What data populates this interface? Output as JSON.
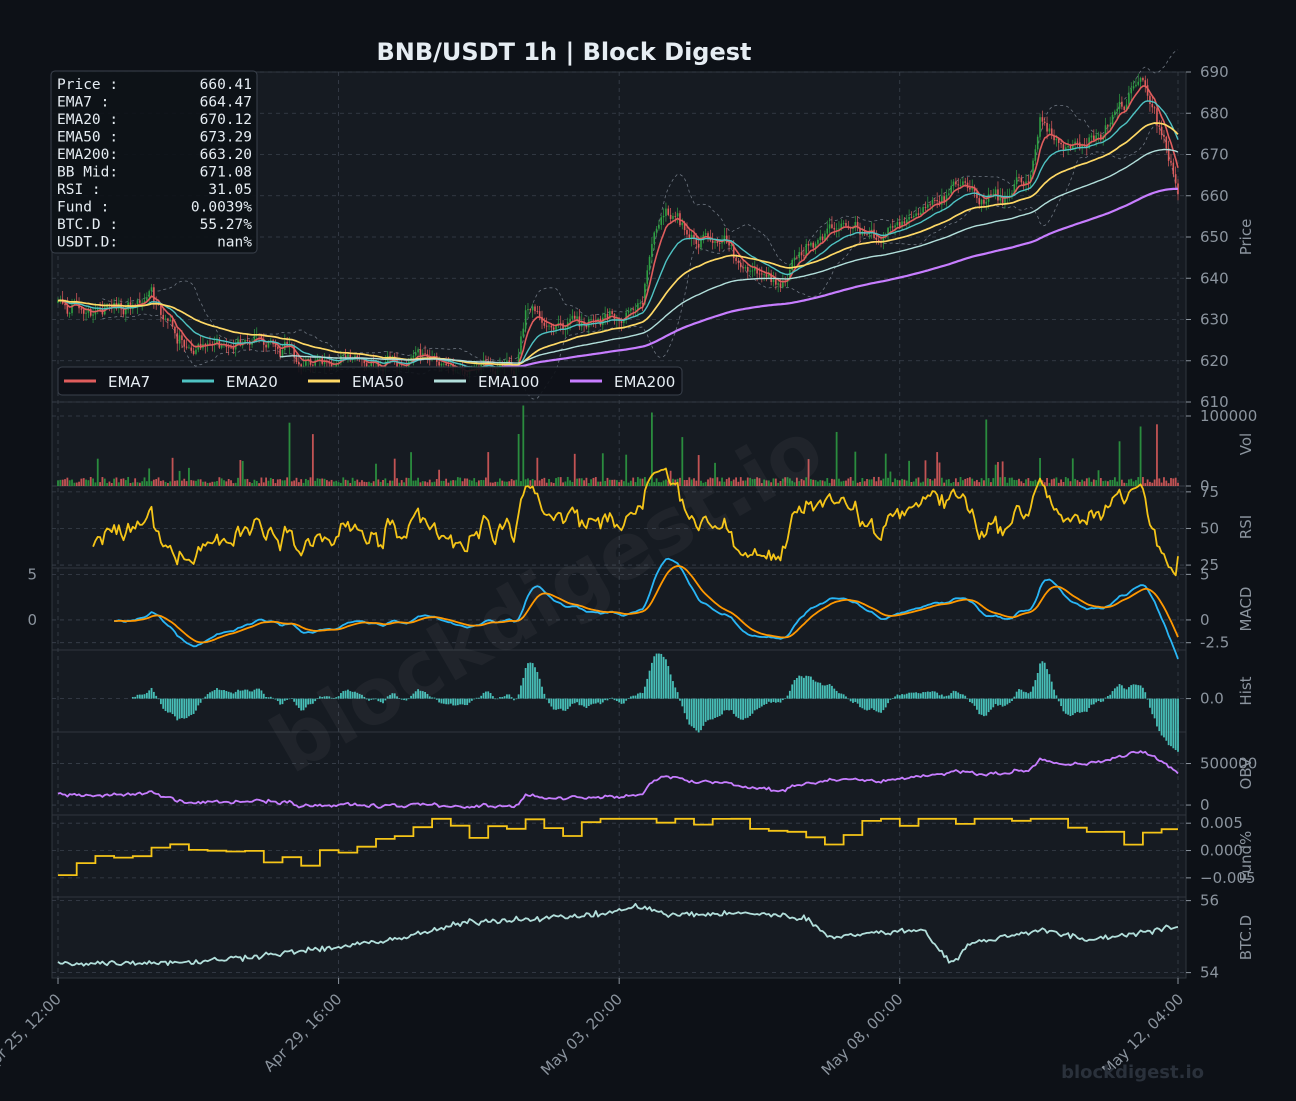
{
  "title": "BNB/USDT  1h  |  Block Digest",
  "watermark": "blockdigest.io",
  "footer_brand": "blockdigest.io",
  "info_box": [
    {
      "label": "Price :",
      "value": "660.41"
    },
    {
      "label": "EMA7  :",
      "value": "664.47"
    },
    {
      "label": "EMA20 :",
      "value": "670.12"
    },
    {
      "label": "EMA50 :",
      "value": "673.29"
    },
    {
      "label": "EMA200:",
      "value": "663.20"
    },
    {
      "label": "BB Mid:",
      "value": "671.08"
    },
    {
      "label": "RSI   :",
      "value": "31.05"
    },
    {
      "label": "Fund  :",
      "value": "0.0039%"
    },
    {
      "label": "BTC.D :",
      "value": "55.27%"
    },
    {
      "label": "USDT.D:",
      "value": "nan%"
    }
  ],
  "legend": [
    {
      "name": "EMA7",
      "color": "#e05d5d"
    },
    {
      "name": "EMA20",
      "color": "#4fc3c3"
    },
    {
      "name": "EMA50",
      "color": "#ffd966"
    },
    {
      "name": "EMA100",
      "color": "#b2dfdb"
    },
    {
      "name": "EMA200",
      "color": "#c77dff"
    }
  ],
  "x_ticks": [
    "Apr 25, 12:00",
    "Apr 29, 16:00",
    "May 03, 20:00",
    "May 08, 00:00",
    "May 12, 04:00"
  ],
  "colors": {
    "background": "#0d1117",
    "panel": "#161b22",
    "grid": "#3a414c",
    "axis_text": "#8b949e",
    "title": "#e6edf3",
    "up": "#2ea043",
    "down": "#e05d5d",
    "rsi": "#f5c518",
    "macd": "#29b6f6",
    "signal": "#ff9800",
    "hist": "#4dd0c8",
    "obv": "#c77dff",
    "fund": "#f5c518",
    "btcd": "#b2dfdb",
    "bb": "#6e7681"
  },
  "chart_data": {
    "type": "line",
    "candles": 480,
    "panels": [
      {
        "name": "Price",
        "ylabel": "Price",
        "ylim": [
          610,
          690
        ],
        "ticks": [
          "610",
          "620",
          "630",
          "640",
          "650",
          "660",
          "670",
          "680",
          "690"
        ],
        "series": [
          "EMA7",
          "EMA20",
          "EMA50",
          "EMA100",
          "EMA200"
        ],
        "price_keypoints": [
          [
            0,
            634
          ],
          [
            15,
            631
          ],
          [
            35,
            633
          ],
          [
            40,
            636
          ],
          [
            42,
            632
          ],
          [
            55,
            625
          ],
          [
            75,
            624
          ],
          [
            90,
            626
          ],
          [
            100,
            624
          ],
          [
            110,
            620
          ],
          [
            140,
            619
          ],
          [
            160,
            618
          ],
          [
            175,
            617
          ],
          [
            195,
            619
          ],
          [
            200,
            630
          ],
          [
            210,
            629
          ],
          [
            230,
            630
          ],
          [
            240,
            631
          ],
          [
            250,
            636
          ],
          [
            255,
            648
          ],
          [
            260,
            656
          ],
          [
            270,
            651
          ],
          [
            280,
            650
          ],
          [
            290,
            645
          ],
          [
            300,
            640
          ],
          [
            310,
            639
          ],
          [
            320,
            648
          ],
          [
            330,
            653
          ],
          [
            340,
            650
          ],
          [
            350,
            649
          ],
          [
            360,
            654
          ],
          [
            370,
            657
          ],
          [
            380,
            660
          ],
          [
            385,
            664
          ],
          [
            395,
            660
          ],
          [
            405,
            660
          ],
          [
            415,
            664
          ],
          [
            420,
            678
          ],
          [
            430,
            672
          ],
          [
            440,
            670
          ],
          [
            445,
            676
          ],
          [
            455,
            683
          ],
          [
            463,
            688
          ],
          [
            470,
            678
          ],
          [
            476,
            668
          ],
          [
            479,
            660
          ]
        ],
        "current_price": 660.41
      },
      {
        "name": "Vol",
        "ylabel": "Vol",
        "ylim": [
          0,
          120000
        ],
        "ticks": [
          "0",
          "100000"
        ]
      },
      {
        "name": "RSI",
        "ylabel": "RSI",
        "ylim": [
          23,
          79
        ],
        "ticks": [
          "25",
          "50",
          "75"
        ],
        "last": 31.05
      },
      {
        "name": "MACD",
        "ylabel": "MACD",
        "ylim": [
          -3.3,
          5.7
        ],
        "ticks": [
          "-2.5",
          "0",
          "5"
        ],
        "left_ticks": [
          "0",
          "5"
        ]
      },
      {
        "name": "Hist",
        "ylabel": "Hist",
        "ylim": [
          -3.3,
          4.8
        ],
        "ticks": [
          "0.0"
        ]
      },
      {
        "name": "OBV",
        "ylabel": "OBV",
        "ylim": [
          -120000,
          880000
        ],
        "ticks": [
          "0",
          "500000"
        ]
      },
      {
        "name": "Fund%",
        "ylabel": "Fund%",
        "ylim": [
          -0.0085,
          0.0065
        ],
        "ticks": [
          "−0.005",
          "0.000",
          "0.005"
        ],
        "last": 0.0039
      },
      {
        "name": "BTC.D",
        "ylabel": "BTC.D",
        "ylim": [
          53.85,
          56.1
        ],
        "ticks": [
          "54",
          "56"
        ],
        "last": 55.27
      }
    ]
  }
}
